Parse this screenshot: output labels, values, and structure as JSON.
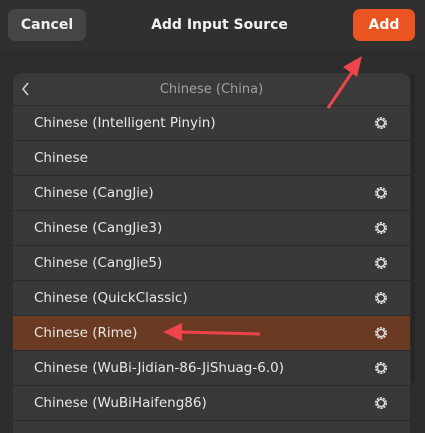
{
  "header": {
    "cancel_label": "Cancel",
    "title": "Add Input Source",
    "add_label": "Add"
  },
  "list": {
    "title": "Chinese (China)",
    "items": [
      {
        "label": "Chinese (Intelligent Pinyin)",
        "has_settings": true,
        "selected": false
      },
      {
        "label": "Chinese",
        "has_settings": false,
        "selected": false
      },
      {
        "label": "Chinese (CangJie)",
        "has_settings": true,
        "selected": false
      },
      {
        "label": "Chinese (CangJie3)",
        "has_settings": true,
        "selected": false
      },
      {
        "label": "Chinese (CangJie5)",
        "has_settings": true,
        "selected": false
      },
      {
        "label": "Chinese (QuickClassic)",
        "has_settings": true,
        "selected": false
      },
      {
        "label": "Chinese (Rime)",
        "has_settings": true,
        "selected": true
      },
      {
        "label": "Chinese (WuBi-Jidian-86-JiShuag-6.0)",
        "has_settings": true,
        "selected": false
      },
      {
        "label": "Chinese (WuBiHaifeng86)",
        "has_settings": true,
        "selected": false
      }
    ]
  },
  "icons": {
    "back": "chevron-left-icon",
    "settings": "gear-icon"
  },
  "colors": {
    "accent": "#e95420",
    "selected_row": "#6b3a22",
    "annotation_arrow": "#f0444c"
  }
}
